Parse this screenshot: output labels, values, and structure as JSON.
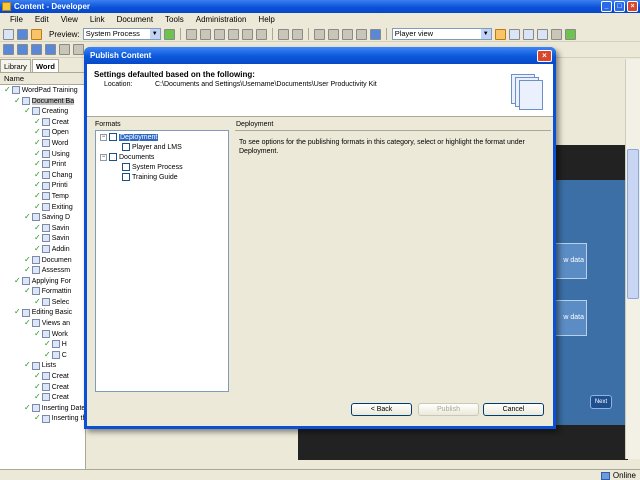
{
  "app": {
    "title": "Content - Developer",
    "menu": [
      "File",
      "Edit",
      "View",
      "Link",
      "Document",
      "Tools",
      "Administration",
      "Help"
    ],
    "toolbar": {
      "preview_label": "Preview:",
      "preview_value": "System Process",
      "view_value": "Player view"
    },
    "tabs": [
      "Library",
      "Word"
    ],
    "column_header": "Name",
    "status": "Online"
  },
  "tree": [
    {
      "label": "WordPad Training",
      "level": 0,
      "icon": "book-icon"
    },
    {
      "label": "Document Ba",
      "level": 1,
      "icon": "book-icon",
      "selected": true
    },
    {
      "label": "Creating",
      "level": 2,
      "icon": "book-icon"
    },
    {
      "label": "Creat",
      "level": 3,
      "icon": "topic-icon"
    },
    {
      "label": "Open",
      "level": 3,
      "icon": "topic-icon"
    },
    {
      "label": "Word",
      "level": 3,
      "icon": "topic-icon"
    },
    {
      "label": "Using",
      "level": 3,
      "icon": "topic-icon"
    },
    {
      "label": "Print",
      "level": 3,
      "icon": "topic-icon"
    },
    {
      "label": "Chang",
      "level": 3,
      "icon": "topic-icon"
    },
    {
      "label": "Printi",
      "level": 3,
      "icon": "topic-icon"
    },
    {
      "label": "Temp",
      "level": 3,
      "icon": "topic-icon"
    },
    {
      "label": "Exiting",
      "level": 3,
      "icon": "topic-icon"
    },
    {
      "label": "Saving D",
      "level": 2,
      "icon": "book-icon"
    },
    {
      "label": "Savin",
      "level": 3,
      "icon": "topic-icon"
    },
    {
      "label": "Savin",
      "level": 3,
      "icon": "topic-icon"
    },
    {
      "label": "Addin",
      "level": 3,
      "icon": "topic-icon"
    },
    {
      "label": "Documen",
      "level": 2,
      "icon": "topic-icon"
    },
    {
      "label": "Assessm",
      "level": 2,
      "icon": "topic-icon"
    },
    {
      "label": "Applying For",
      "level": 1,
      "icon": "book-icon"
    },
    {
      "label": "Formattin",
      "level": 2,
      "icon": "book-icon"
    },
    {
      "label": "Selec",
      "level": 3,
      "icon": "topic-icon"
    },
    {
      "label": "Editing Basic",
      "level": 1,
      "icon": "book-icon"
    },
    {
      "label": "Views an",
      "level": 2,
      "icon": "book-icon"
    },
    {
      "label": "Work",
      "level": 3,
      "icon": "book-icon"
    },
    {
      "label": "H",
      "level": 4,
      "icon": "topic-icon"
    },
    {
      "label": "C",
      "level": 4,
      "icon": "topic-icon"
    },
    {
      "label": "Lists",
      "level": 2,
      "icon": "book-icon"
    },
    {
      "label": "Creat",
      "level": 3,
      "icon": "topic-icon"
    },
    {
      "label": "Creat",
      "level": 3,
      "icon": "topic-icon"
    },
    {
      "label": "Creat",
      "level": 3,
      "icon": "topic-icon"
    },
    {
      "label": "Inserting Dates and Objects",
      "level": 2,
      "icon": "book-icon"
    },
    {
      "label": "Inserting the Date",
      "level": 3,
      "icon": "topic-icon"
    }
  ],
  "stage": {
    "box1": "w data",
    "box2": "w data",
    "next": "Next"
  },
  "dialog": {
    "title": "Publish Content",
    "heading": "Settings defaulted based on the following:",
    "location_label": "Location:",
    "location_value": "C:\\Documents and Settings\\Username\\Documents\\User Productivity Kit",
    "formats_label": "Formats",
    "formats": [
      {
        "label": "Deployment",
        "level": 0,
        "expander": "−",
        "selected": true
      },
      {
        "label": "Player and LMS",
        "level": 1
      },
      {
        "label": "Documents",
        "level": 0,
        "expander": "−"
      },
      {
        "label": "System Process",
        "level": 1
      },
      {
        "label": "Training Guide",
        "level": 1
      }
    ],
    "section_title": "Deployment",
    "section_text": "To see options for the publishing formats in this category, select or highlight the format under Deployment.",
    "back_label": "< Back",
    "publish_label": "Publish",
    "cancel_label": "Cancel"
  }
}
